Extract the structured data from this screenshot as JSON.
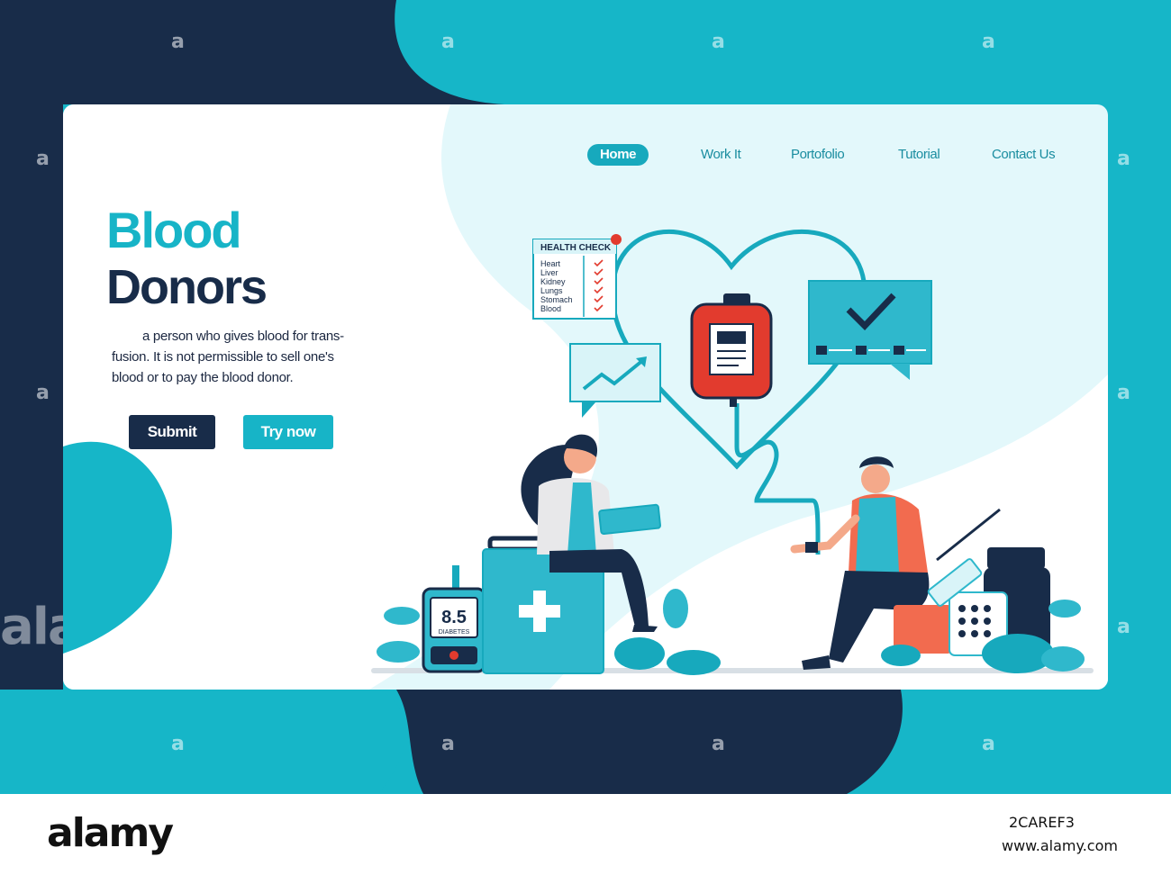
{
  "nav": {
    "items": [
      "Home",
      "Work It",
      "Portofolio",
      "Tutorial",
      "Contact Us"
    ],
    "active": "Home"
  },
  "hero": {
    "title_line1": "Blood",
    "title_line2": "Donors",
    "description": "a person who gives blood for trans-fusion. It is not permissible to sell one's blood or to pay the blood donor.",
    "submit_label": "Submit",
    "try_label": "Try now"
  },
  "illustration": {
    "health_check_title": "HEALTH CHECK",
    "health_check_items": [
      "Heart",
      "Liver",
      "Kidney",
      "Lungs",
      "Stomach",
      "Blood"
    ],
    "glucose_value": "8.5",
    "glucose_label": "DIABETES"
  },
  "watermark": {
    "small": "a",
    "large": "alamy"
  },
  "footer": {
    "logo": "alamy",
    "image_id": "2CAREF3",
    "url": "www.alamy.com"
  },
  "colors": {
    "teal": "#17b4c7",
    "navy": "#182c49",
    "card_bg": "#e3f8fb",
    "blood_red": "#e23b2e"
  }
}
